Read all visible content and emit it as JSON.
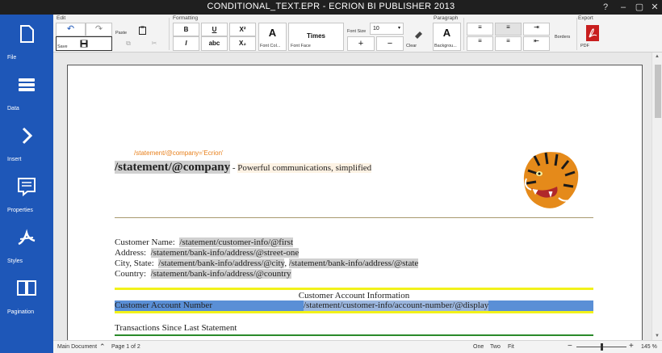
{
  "window": {
    "title": "CONDITIONAL_TEXT.EPR - ECRION BI PUBLISHER 2013",
    "controls": [
      "?",
      "–",
      "▢",
      "✕"
    ]
  },
  "sidebar": {
    "items": [
      {
        "label": "File",
        "icon": "document-icon"
      },
      {
        "label": "Data",
        "icon": "stack-icon"
      },
      {
        "label": "Insert",
        "icon": "chevron-right-icon"
      },
      {
        "label": "Properties",
        "icon": "comment-list-icon"
      },
      {
        "label": "Styles",
        "icon": "font-style-icon"
      },
      {
        "label": "Pagination",
        "icon": "book-icon"
      }
    ]
  },
  "ribbon": {
    "groups": {
      "edit": "Edit",
      "formatting": "Formatting",
      "font_size": "Font Size",
      "paragraph": "Paragraph",
      "export": "Export"
    },
    "edit": {
      "undo": "↶",
      "redo": "↷",
      "paste": "Paste",
      "save": "Save"
    },
    "formatting": {
      "bold": "B",
      "underline": "U",
      "superscript": "X²",
      "italic": "I",
      "strikethrough": "abc",
      "subscript": "X₂",
      "font_color_glyph": "A",
      "font_color": "Font Col...",
      "font_face_value": "Times",
      "font_face": "Font Face",
      "font_size_value": "10",
      "increase": "+",
      "decrease": "−",
      "clear": "Clear",
      "background_glyph": "A",
      "background": "Backgrou..."
    },
    "paragraph": {
      "borders": "Borders"
    },
    "export": {
      "pdf": "PDF"
    }
  },
  "document": {
    "conditional_tag": "/statement/@company='Ecrion'",
    "company_field": "/statement/@company",
    "tagline_sep": " - ",
    "tagline": "Powerful communications, simplified",
    "customer": {
      "name_label": "Customer Name:",
      "name_value": "/statement/customer-info/@first",
      "address_label": "Address:",
      "address_value": "/statement/bank-info/address/@street-one",
      "city_label": "City, State:",
      "city_value": "/statement/bank-info/address/@city",
      "city_sep": ",",
      "state_value": "/statement/bank-info/address/@state",
      "country_label": "Country:",
      "country_value": "/statement/bank-info/address/@country"
    },
    "account_header": "Customer Account Information",
    "account_label": "Customer Account Number",
    "account_value": "/statement/customer-info/account-number/@display",
    "transactions_title": "Transactions Since Last Statement"
  },
  "statusbar": {
    "main_document": "Main Document",
    "page": "Page 1 of 2",
    "view_one": "One",
    "view_two": "Two",
    "view_fit": "Fit",
    "zoom": "145 %"
  },
  "colors": {
    "sidebar": "#1e57b8",
    "conditional_tag": "#e8801c",
    "account_row": "#5a8fd6",
    "yellow_rule": "#f2f21a",
    "green_rule": "#2a8a2a"
  }
}
